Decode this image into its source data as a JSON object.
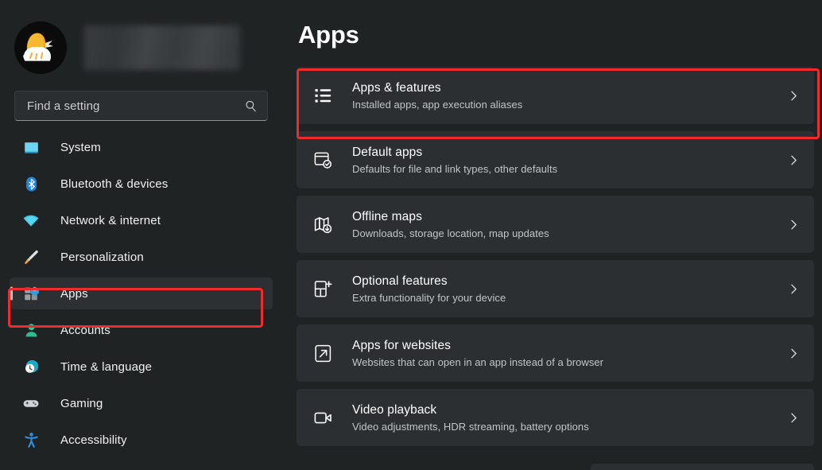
{
  "window": {
    "background_color": "#202324",
    "card_color": "#2b2f31",
    "highlight_color": "#ef2b2b"
  },
  "sidebar": {
    "account": {
      "name_redacted": "",
      "avatar_icon": "chick-hatching-avatar"
    },
    "search": {
      "placeholder": "Find a setting",
      "value": "",
      "icon": "search-icon"
    },
    "items": [
      {
        "label": "System",
        "icon": "monitor-icon",
        "selected": false
      },
      {
        "label": "Bluetooth & devices",
        "icon": "bluetooth-icon",
        "selected": false
      },
      {
        "label": "Network & internet",
        "icon": "wifi-icon",
        "selected": false
      },
      {
        "label": "Personalization",
        "icon": "paintbrush-icon",
        "selected": false
      },
      {
        "label": "Apps",
        "icon": "apps-grid-icon",
        "selected": true
      },
      {
        "label": "Accounts",
        "icon": "person-icon",
        "selected": false
      },
      {
        "label": "Time & language",
        "icon": "clock-globe-icon",
        "selected": false
      },
      {
        "label": "Gaming",
        "icon": "gamepad-icon",
        "selected": false
      },
      {
        "label": "Accessibility",
        "icon": "accessibility-icon",
        "selected": false
      }
    ]
  },
  "main": {
    "title": "Apps",
    "cards": [
      {
        "title": "Apps & features",
        "subtitle": "Installed apps, app execution aliases",
        "icon": "list-bullets-icon",
        "highlighted": true
      },
      {
        "title": "Default apps",
        "subtitle": "Defaults for file and link types, other defaults",
        "icon": "app-check-icon",
        "highlighted": false
      },
      {
        "title": "Offline maps",
        "subtitle": "Downloads, storage location, map updates",
        "icon": "map-download-icon",
        "highlighted": false
      },
      {
        "title": "Optional features",
        "subtitle": "Extra functionality for your device",
        "icon": "grid-plus-icon",
        "highlighted": false
      },
      {
        "title": "Apps for websites",
        "subtitle": "Websites that can open in an app instead of a browser",
        "icon": "external-link-icon",
        "highlighted": false
      },
      {
        "title": "Video playback",
        "subtitle": "Video adjustments, HDR streaming, battery options",
        "icon": "video-camera-icon",
        "highlighted": false
      }
    ],
    "chevron_icon": "chevron-right-icon"
  }
}
